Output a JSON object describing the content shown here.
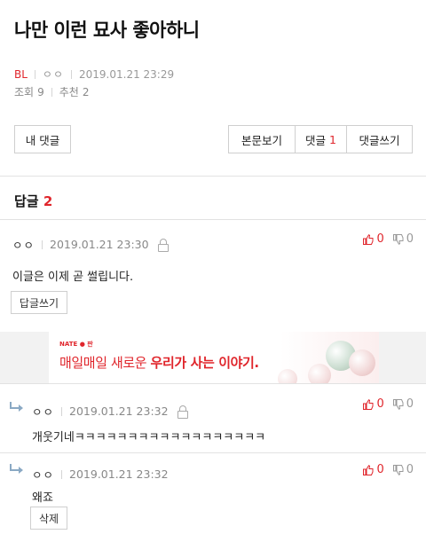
{
  "post": {
    "title": "나만 이런 묘사 좋아하니",
    "category": "BL",
    "author": "ㅇㅇ",
    "datetime": "2019.01.21 23:29",
    "views_label": "조회",
    "views": "9",
    "recommend_label": "추천",
    "recommend": "2"
  },
  "toolbar": {
    "my_comments_label": "내 댓글",
    "view_post_label": "본문보기",
    "comments_label": "댓글",
    "comments_count": "1",
    "write_comment_label": "댓글쓰기"
  },
  "replies": {
    "label": "답글",
    "count": "2"
  },
  "comments": [
    {
      "author": "ㅇㅇ",
      "datetime": "2019.01.21 23:30",
      "text": "이글은 이제 곧 썰립니다.",
      "up": "0",
      "down": "0",
      "action_label": "답글쓰기"
    },
    {
      "author": "ㅇㅇ",
      "datetime": "2019.01.21 23:32",
      "text": "개웃기네ㅋㅋㅋㅋㅋㅋㅋㅋㅋㅋㅋㅋㅋㅋㅋㅋㅋㅋ",
      "up": "0",
      "down": "0"
    },
    {
      "author": "ㅇㅇ",
      "datetime": "2019.01.21 23:32",
      "text": "왜죠",
      "up": "0",
      "down": "0",
      "action_label": "삭제"
    }
  ],
  "ad": {
    "brand": "NATE ● 판",
    "slogan_plain": "매일매일 새로운 ",
    "slogan_bold": "우리가 사는 이야기."
  },
  "colors": {
    "accent": "#e0262c",
    "muted": "#999999",
    "border": "#cfcfcf"
  },
  "icons": {
    "lock": "lock-icon",
    "thumbs_up": "thumbs-up-icon",
    "thumbs_down": "thumbs-down-icon",
    "reply_arrow": "reply-arrow-icon"
  }
}
